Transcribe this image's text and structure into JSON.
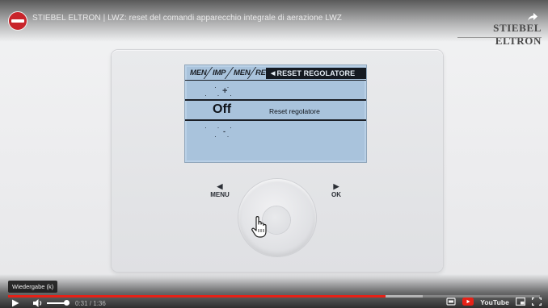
{
  "video": {
    "title": "STIEBEL ELTRON | LWZ: reset del comandi apparecchio integrale di aerazione LWZ",
    "brand": "STIEBEL ELTRON"
  },
  "panel": {
    "breadcrumb": [
      "MEN",
      "IMP",
      "MEN",
      "RE"
    ],
    "active_crumb": "RESET REGOLATORE",
    "value": "Off",
    "setting_label": "Reset regolatore",
    "left_label": "MENU",
    "right_label": "OK"
  },
  "player": {
    "tooltip": "Wiedergabe (k)",
    "time": "0:31 / 1:36",
    "progress_played": 0.71,
    "progress_buffered": 0.78,
    "volume_level": 0.85,
    "logo": "YouTube"
  },
  "colors": {
    "lcd_background": "#a9c3dc",
    "progress_red": "#e62117",
    "brand_dark": "#4a4a4a"
  },
  "icons": [
    "share-icon",
    "play-icon",
    "volume-icon",
    "settings-icon",
    "youtube-logo",
    "miniplayer-icon",
    "fullscreen-icon",
    "hand-cursor-icon"
  ]
}
